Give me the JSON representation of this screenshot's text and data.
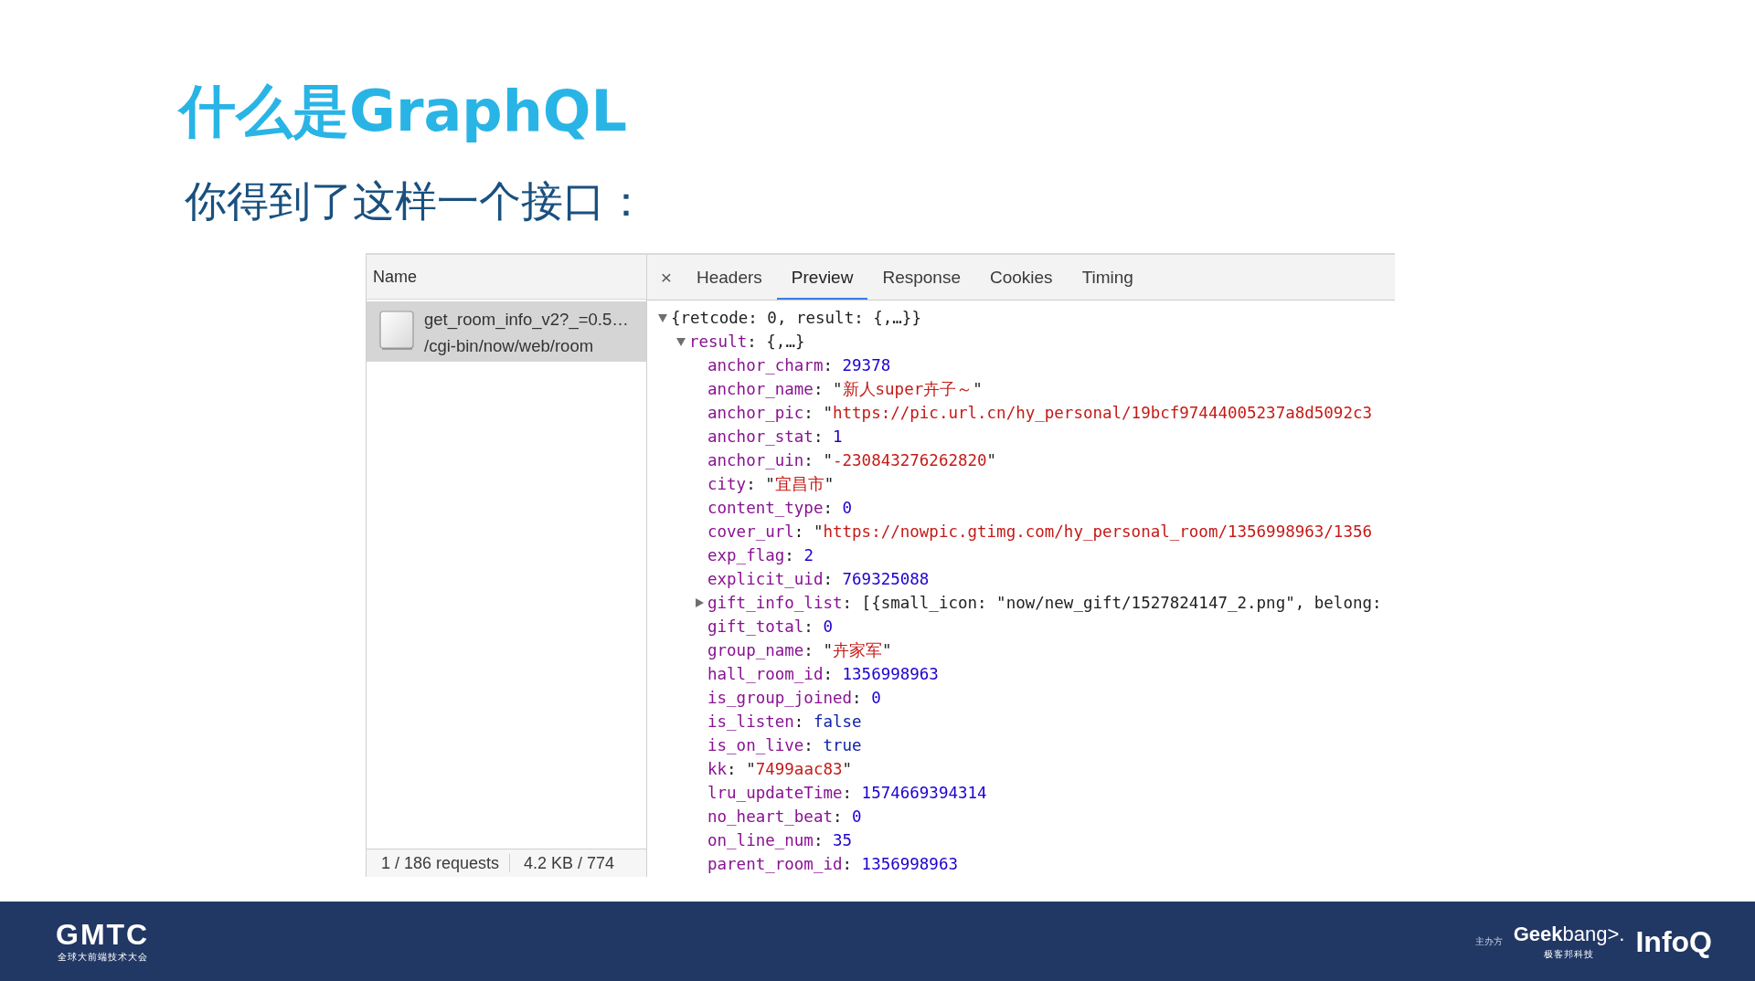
{
  "title": "什么是GraphQL",
  "subtitle": "你得到了这样一个接口：",
  "devtools": {
    "request_list": {
      "header": "Name",
      "requests": [
        {
          "name": "get_room_info_v2?_=0.5…",
          "path": "/cgi-bin/now/web/room",
          "selected": true
        }
      ],
      "status": {
        "requests": "1 / 186 requests",
        "transferred": "4.2 KB / 774"
      }
    },
    "close": "×",
    "tabs": [
      {
        "label": "Headers",
        "selected": false
      },
      {
        "label": "Preview",
        "selected": true
      },
      {
        "label": "Response",
        "selected": false
      },
      {
        "label": "Cookies",
        "selected": false
      },
      {
        "label": "Timing",
        "selected": false
      }
    ],
    "preview": {
      "tree": [
        {
          "kind": "summary",
          "value": "{retcode: 0, result: {,…}}",
          "expanded": true,
          "children": [
            {
              "key": "result:",
              "kind": "summary",
              "value": "{,…}",
              "expanded": true,
              "children": [
                {
                  "key": "anchor_charm:",
                  "kind": "number",
                  "value": "29378"
                },
                {
                  "key": "anchor_name:",
                  "kind": "string",
                  "open_quote": "\"",
                  "value": "新人super卉子～",
                  "close_quote": "\""
                },
                {
                  "key": "anchor_pic:",
                  "kind": "string",
                  "open_quote": "\"",
                  "value": "https://pic.url.cn/hy_personal/19bcf97444005237a8d5092c3"
                },
                {
                  "key": "anchor_stat:",
                  "kind": "number",
                  "value": "1"
                },
                {
                  "key": "anchor_uin:",
                  "kind": "string",
                  "open_quote": "\"",
                  "value": "-230843276262820",
                  "close_quote": "\""
                },
                {
                  "key": "city:",
                  "kind": "string",
                  "open_quote": "\"",
                  "value": "宜昌市",
                  "close_quote": "\""
                },
                {
                  "key": "content_type:",
                  "kind": "number",
                  "value": "0"
                },
                {
                  "key": "cover_url:",
                  "kind": "string",
                  "open_quote": "\"",
                  "value": "https://nowpic.gtimg.com/hy_personal_room/1356998963/1356"
                },
                {
                  "key": "exp_flag:",
                  "kind": "number",
                  "value": "2"
                },
                {
                  "key": "explicit_uid:",
                  "kind": "number",
                  "value": "769325088"
                },
                {
                  "key": "gift_info_list:",
                  "kind": "summary",
                  "value": "[{small_icon: \"now/new_gift/1527824147_2.png\", belong:",
                  "expanded": false
                },
                {
                  "key": "gift_total:",
                  "kind": "number",
                  "value": "0"
                },
                {
                  "key": "group_name:",
                  "kind": "string",
                  "open_quote": "\"",
                  "value": "卉家军",
                  "close_quote": "\""
                },
                {
                  "key": "hall_room_id:",
                  "kind": "number",
                  "value": "1356998963"
                },
                {
                  "key": "is_group_joined:",
                  "kind": "number",
                  "value": "0"
                },
                {
                  "key": "is_listen:",
                  "kind": "boolean",
                  "value": "false"
                },
                {
                  "key": "is_on_live:",
                  "kind": "boolean",
                  "value": "true"
                },
                {
                  "key": "kk:",
                  "kind": "string",
                  "open_quote": "\"",
                  "value": "7499aac83",
                  "close_quote": "\""
                },
                {
                  "key": "lru_updateTime:",
                  "kind": "number",
                  "value": "1574669394314"
                },
                {
                  "key": "no_heart_beat:",
                  "kind": "number",
                  "value": "0"
                },
                {
                  "key": "on_line_num:",
                  "kind": "number",
                  "value": "35"
                },
                {
                  "key": "parent_room_id:",
                  "kind": "number",
                  "value": "1356998963"
                }
              ]
            }
          ]
        }
      ]
    }
  },
  "footer": {
    "logo": {
      "name": "GMTC",
      "tagline": "全球大前端技术大会"
    },
    "organizer_label": "主办方",
    "sponsors": [
      {
        "name": "**Geek**bang>.",
        "tagline": "极客邦科技"
      },
      {
        "name": "InfoQ"
      }
    ]
  }
}
